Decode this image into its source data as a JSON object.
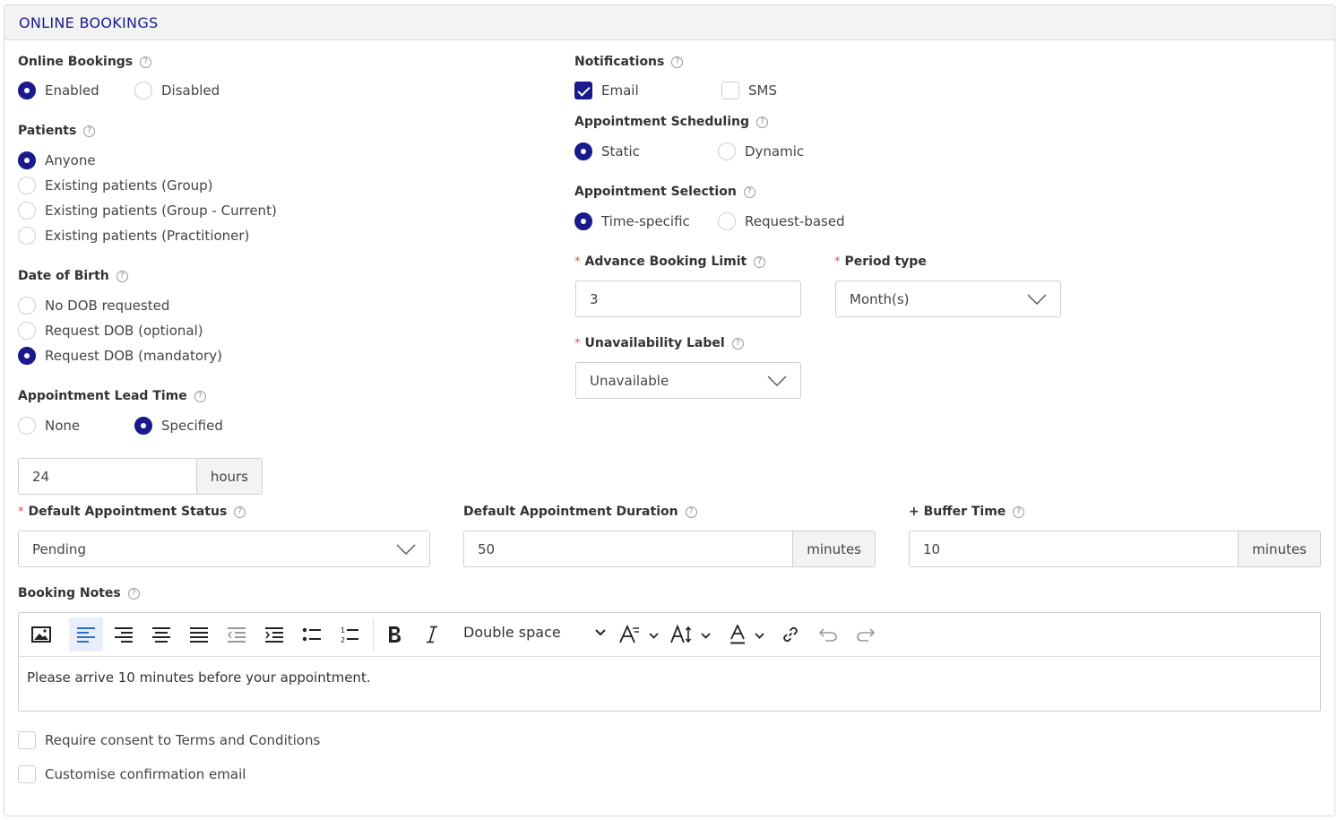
{
  "header": {
    "title": "ONLINE BOOKINGS"
  },
  "online_bookings": {
    "label": "Online Bookings",
    "options": [
      "Enabled",
      "Disabled"
    ],
    "selected": "Enabled"
  },
  "patients": {
    "label": "Patients",
    "options": [
      "Anyone",
      "Existing patients (Group)",
      "Existing patients (Group - Current)",
      "Existing patients (Practitioner)"
    ],
    "selected": "Anyone"
  },
  "dob": {
    "label": "Date of Birth",
    "options": [
      "No DOB requested",
      "Request DOB (optional)",
      "Request DOB (mandatory)"
    ],
    "selected": "Request DOB (mandatory)"
  },
  "lead_time": {
    "label": "Appointment Lead Time",
    "options": [
      "None",
      "Specified"
    ],
    "selected": "Specified",
    "value": "24",
    "unit": "hours"
  },
  "notifications": {
    "label": "Notifications",
    "options": [
      "Email",
      "SMS"
    ],
    "checked": [
      "Email"
    ]
  },
  "scheduling": {
    "label": "Appointment Scheduling",
    "options": [
      "Static",
      "Dynamic"
    ],
    "selected": "Static"
  },
  "selection": {
    "label": "Appointment Selection",
    "options": [
      "Time-specific",
      "Request-based"
    ],
    "selected": "Time-specific"
  },
  "advance_limit": {
    "label": "Advance Booking Limit",
    "value": "3"
  },
  "period_type": {
    "label": "Period type",
    "value": "Month(s)"
  },
  "unavailability": {
    "label": "Unavailability Label",
    "value": "Unavailable"
  },
  "default_status": {
    "label": "Default Appointment Status",
    "value": "Pending"
  },
  "default_duration": {
    "label": "Default Appointment Duration",
    "value": "50",
    "unit": "minutes"
  },
  "buffer": {
    "label": "+ Buffer Time",
    "value": "10",
    "unit": "minutes"
  },
  "booking_notes": {
    "label": "Booking Notes",
    "line_spacing": "Double space",
    "content": "Please arrive 10 minutes before your appointment.",
    "toolbar": [
      "image-icon",
      "align-left-icon",
      "align-right-icon",
      "align-center-icon",
      "align-justify-icon",
      "outdent-icon",
      "indent-icon",
      "bullet-list-icon",
      "numbered-list-icon",
      "bold-icon",
      "italic-icon",
      "font-family-icon",
      "font-size-icon",
      "font-color-icon",
      "link-icon",
      "undo-icon",
      "redo-icon"
    ]
  },
  "consent": {
    "terms": "Require consent to Terms and Conditions",
    "confirmation": "Customise confirmation email"
  },
  "help_glyph": "?",
  "required_mark": "*",
  "accent": "#1a1a8c",
  "required_color": "#d9534f"
}
